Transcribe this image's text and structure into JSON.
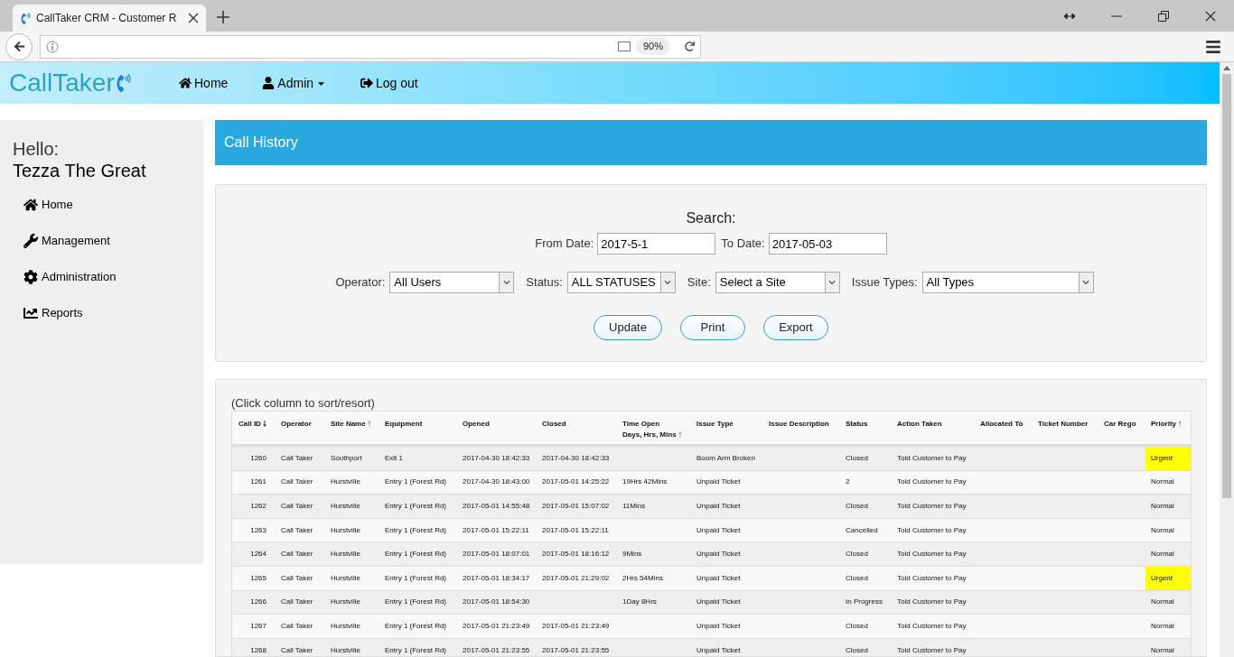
{
  "browser": {
    "tab_title": "CallTaker CRM - Customer R",
    "zoom": "90%"
  },
  "navbar": {
    "brand": "CallTaker",
    "items": [
      {
        "label": "Home",
        "kind": "home"
      },
      {
        "label": "Admin",
        "kind": "user",
        "dropdown": true
      },
      {
        "label": "Log out",
        "kind": "logout"
      }
    ]
  },
  "sidebar": {
    "greeting": "Hello:",
    "user": "Tezza The Great",
    "items": [
      {
        "label": "Home",
        "kind": "home"
      },
      {
        "label": "Management",
        "kind": "wrench"
      },
      {
        "label": "Administration",
        "kind": "gear"
      },
      {
        "label": "Reports",
        "kind": "chart"
      }
    ]
  },
  "page_title": "Call History",
  "search": {
    "title": "Search:",
    "from_label": "From Date:",
    "from_value": "2017-5-1",
    "to_label": "To Date:",
    "to_value": "2017-05-03",
    "filters": [
      {
        "label": "Operator:",
        "value": "All Users"
      },
      {
        "label": "Status:",
        "value": "ALL STATUSES"
      },
      {
        "label": "Site:",
        "value": "Select a Site"
      },
      {
        "label": "Issue Types:",
        "value": "All Types"
      }
    ],
    "buttons": [
      "Update",
      "Print",
      "Export"
    ]
  },
  "table": {
    "hint": "(Click column to sort/resort)",
    "columns": [
      {
        "label": "Call ID",
        "sorted": true,
        "descending": true
      },
      {
        "label": "Operator",
        "sorted": false
      },
      {
        "label": "Site Name",
        "sorted": true,
        "descending": false
      },
      {
        "label": "Equipment",
        "sorted": false
      },
      {
        "label": "Opened",
        "sorted": false
      },
      {
        "label": "Closed",
        "sorted": false
      },
      {
        "label": "Time Open",
        "sublabel": "Days, Hrs, Mins",
        "sorted": true,
        "descending": false
      },
      {
        "label": "Issue Type",
        "sorted": false
      },
      {
        "label": "Issue Description",
        "sorted": false
      },
      {
        "label": "Status",
        "sorted": false
      },
      {
        "label": "Action Taken",
        "sorted": false
      },
      {
        "label": "Allocated To",
        "sorted": false
      },
      {
        "label": "Ticket Number",
        "sorted": false
      },
      {
        "label": "Car Rego",
        "sorted": false
      },
      {
        "label": "Priority",
        "sorted": true,
        "descending": false
      }
    ],
    "rows": [
      {
        "urgent": true,
        "cells": [
          "1260",
          "Call Taker",
          "Southport",
          "Exit 1",
          "2017-04-30 18:42:33",
          "2017-04-30 18:42:33",
          "",
          "Boom Arm Broken",
          "",
          "Closed",
          "Told Customer to Pay",
          "",
          "",
          "",
          "Urgent"
        ]
      },
      {
        "urgent": false,
        "cells": [
          "1261",
          "Call Taker",
          "Hurstville",
          "Entry 1 (Forest Rd)",
          "2017-04-30 18:43:00",
          "2017-05-01 14:25:22",
          "19Hrs 42Mins",
          "Unpaid Ticket",
          "",
          "2",
          "Told Customer to Pay",
          "",
          "",
          "",
          "Normal"
        ]
      },
      {
        "urgent": false,
        "cells": [
          "1262",
          "Call Taker",
          "Hurstville",
          "Entry 1 (Forest Rd)",
          "2017-05-01 14:55:48",
          "2017-05-01 15:07:02",
          "11Mins",
          "Unpaid Ticket",
          "",
          "Closed",
          "Told Customer to Pay",
          "",
          "",
          "",
          "Normal"
        ]
      },
      {
        "urgent": false,
        "cells": [
          "1263",
          "Call Taker",
          "Hurstville",
          "Entry 1 (Forest Rd)",
          "2017-05-01 15:22:11",
          "2017-05-01 15:22:11",
          "",
          "Unpaid Ticket",
          "",
          "Cancelled",
          "Told Customer to Pay",
          "",
          "",
          "",
          "Normal"
        ]
      },
      {
        "urgent": false,
        "cells": [
          "1264",
          "Call Taker",
          "Hurstville",
          "Entry 1 (Forest Rd)",
          "2017-05-01 18:07:01",
          "2017-05-01 18:16:12",
          "9Mins",
          "Unpaid Ticket",
          "",
          "Closed",
          "Told Customer to Pay",
          "",
          "",
          "",
          "Normal"
        ]
      },
      {
        "urgent": true,
        "cells": [
          "1265",
          "Call Taker",
          "Hurstville",
          "Entry 1 (Forest Rd)",
          "2017-05-01 18:34:17",
          "2017-05-01 21:29:02",
          "2Hrs 54Mins",
          "Unpaid Ticket",
          "",
          "Closed",
          "Told Customer to Pay",
          "",
          "",
          "",
          "Urgent"
        ]
      },
      {
        "urgent": false,
        "cells": [
          "1266",
          "Call Taker",
          "Hurstville",
          "Entry 1 (Forest Rd)",
          "2017-05-01 18:54:30",
          "",
          "1Day 8Hrs",
          "Unpaid Ticket",
          "",
          "In Progress",
          "Told Customer to Pay",
          "",
          "",
          "",
          "Normal"
        ]
      },
      {
        "urgent": false,
        "cells": [
          "1267",
          "Call Taker",
          "Hurstville",
          "Entry 1 (Forest Rd)",
          "2017-05-01 21:23:49",
          "2017-05-01 21:23:49",
          "",
          "Unpaid Ticket",
          "",
          "Closed",
          "Told Customer to Pay",
          "",
          "",
          "",
          "Normal"
        ]
      },
      {
        "urgent": false,
        "cells": [
          "1268",
          "Call Taker",
          "Hurstville",
          "Entry 1 (Forest Rd)",
          "2017-05-01 21:23:55",
          "2017-05-01 21:23:55",
          "",
          "Unpaid Ticket",
          "",
          "Closed",
          "Told Customer to Pay",
          "",
          "",
          "",
          "Normal"
        ]
      }
    ]
  }
}
